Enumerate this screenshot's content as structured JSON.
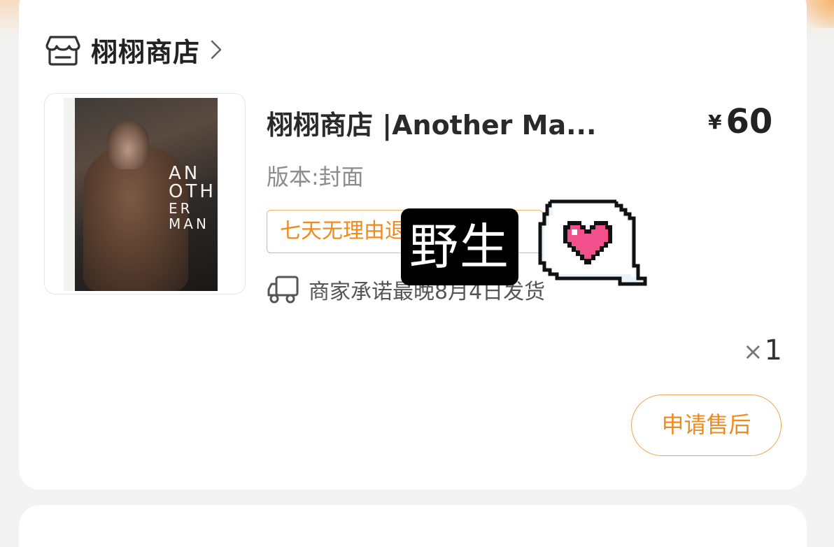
{
  "shop": {
    "name": "栩栩商店",
    "icon": "store-icon",
    "chevron": "chevron-right-icon"
  },
  "product": {
    "title": "栩栩商店 |Another Ma...",
    "price_currency": "¥",
    "price": "60",
    "variant": "版本:封面",
    "service_tag": "七天无理由退货认证",
    "delivery_icon": "truck-icon",
    "delivery_text": "商家承诺最晚8月4日发货",
    "quantity_prefix": "×",
    "quantity": "1"
  },
  "cover": {
    "line1": "AN",
    "line2": "OTH",
    "line3": "ER",
    "line4": "MAN"
  },
  "actions": {
    "after_sale": "申请售后"
  },
  "stickers": {
    "text": "野生",
    "heart": "pixel-heart-speech-bubble"
  },
  "colors": {
    "accent": "#f08a1d",
    "accent_border": "#f4b46c",
    "heart": "#f2508c"
  }
}
